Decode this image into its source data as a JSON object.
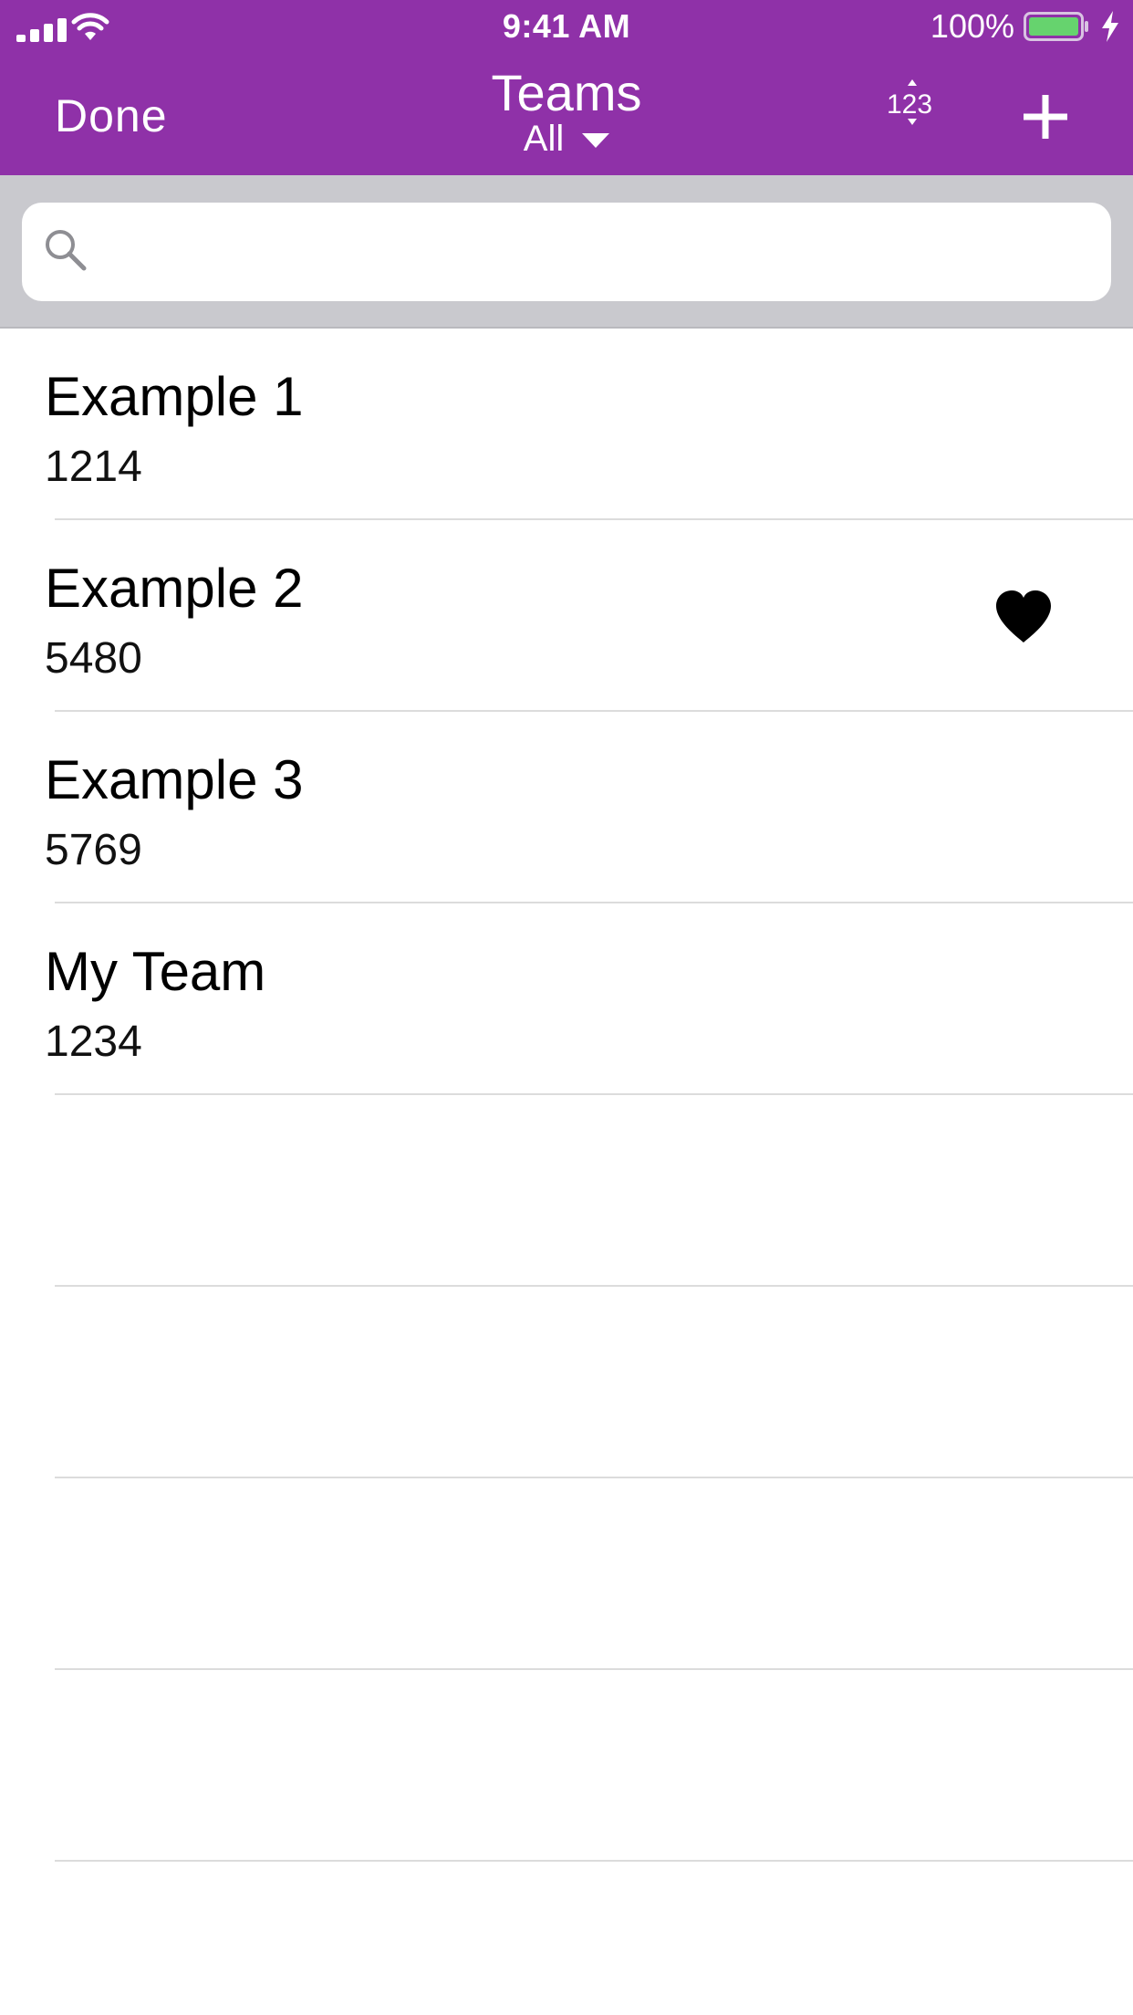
{
  "status_bar": {
    "time": "9:41 AM",
    "battery_percent": "100%",
    "icons": [
      "signal-icon",
      "wifi-icon",
      "battery-icon",
      "charging-bolt-icon"
    ]
  },
  "nav": {
    "done_label": "Done",
    "title": "Teams",
    "filter_label": "All",
    "sort_icon": "sort-123-icon",
    "add_icon": "plus-icon",
    "background_color": "#8f31a8"
  },
  "search": {
    "placeholder": "",
    "value": "",
    "icon": "search-icon"
  },
  "teams": [
    {
      "name": "Example 1",
      "number": "1214",
      "favorite": false
    },
    {
      "name": "Example 2",
      "number": "5480",
      "favorite": true
    },
    {
      "name": "Example 3",
      "number": "5769",
      "favorite": false
    },
    {
      "name": "My Team",
      "number": "1234",
      "favorite": false
    }
  ],
  "empty_rows": 4
}
